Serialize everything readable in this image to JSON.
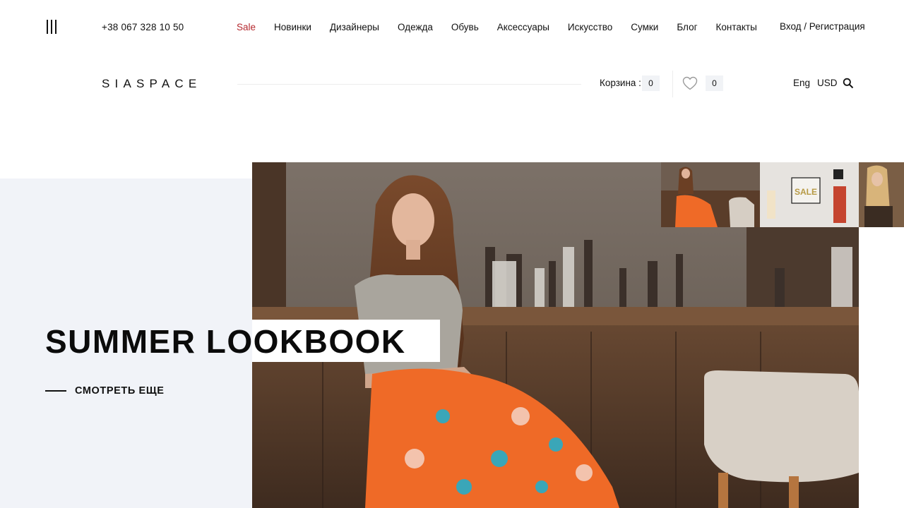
{
  "header": {
    "menu_icon": "hamburger-icon",
    "phone": "+38 067 328 10 50",
    "nav": [
      {
        "label": "Sale",
        "highlight": true
      },
      {
        "label": "Новинки"
      },
      {
        "label": "Дизайнеры"
      },
      {
        "label": "Одежда"
      },
      {
        "label": "Обувь"
      },
      {
        "label": "Аксессуары"
      },
      {
        "label": "Искусство"
      },
      {
        "label": "Сумки"
      },
      {
        "label": "Блог"
      },
      {
        "label": "Контакты"
      }
    ],
    "login": "Вход / Регистрация",
    "sale_color": "#b5292f"
  },
  "brandbar": {
    "logo": "SIASPACE",
    "cart_label": "Корзина :",
    "cart_count": "0",
    "favorites_icon": "heart-icon",
    "favorites_count": "0",
    "language": "Eng",
    "currency": "USD",
    "search_icon": "search-icon"
  },
  "hero": {
    "title": "SUMMER LOOKBOOK",
    "cta": "СМОТРЕТЬ ЕЩЕ",
    "panel_color": "#f1f3f8",
    "thumb_sale_text": "SALE"
  }
}
